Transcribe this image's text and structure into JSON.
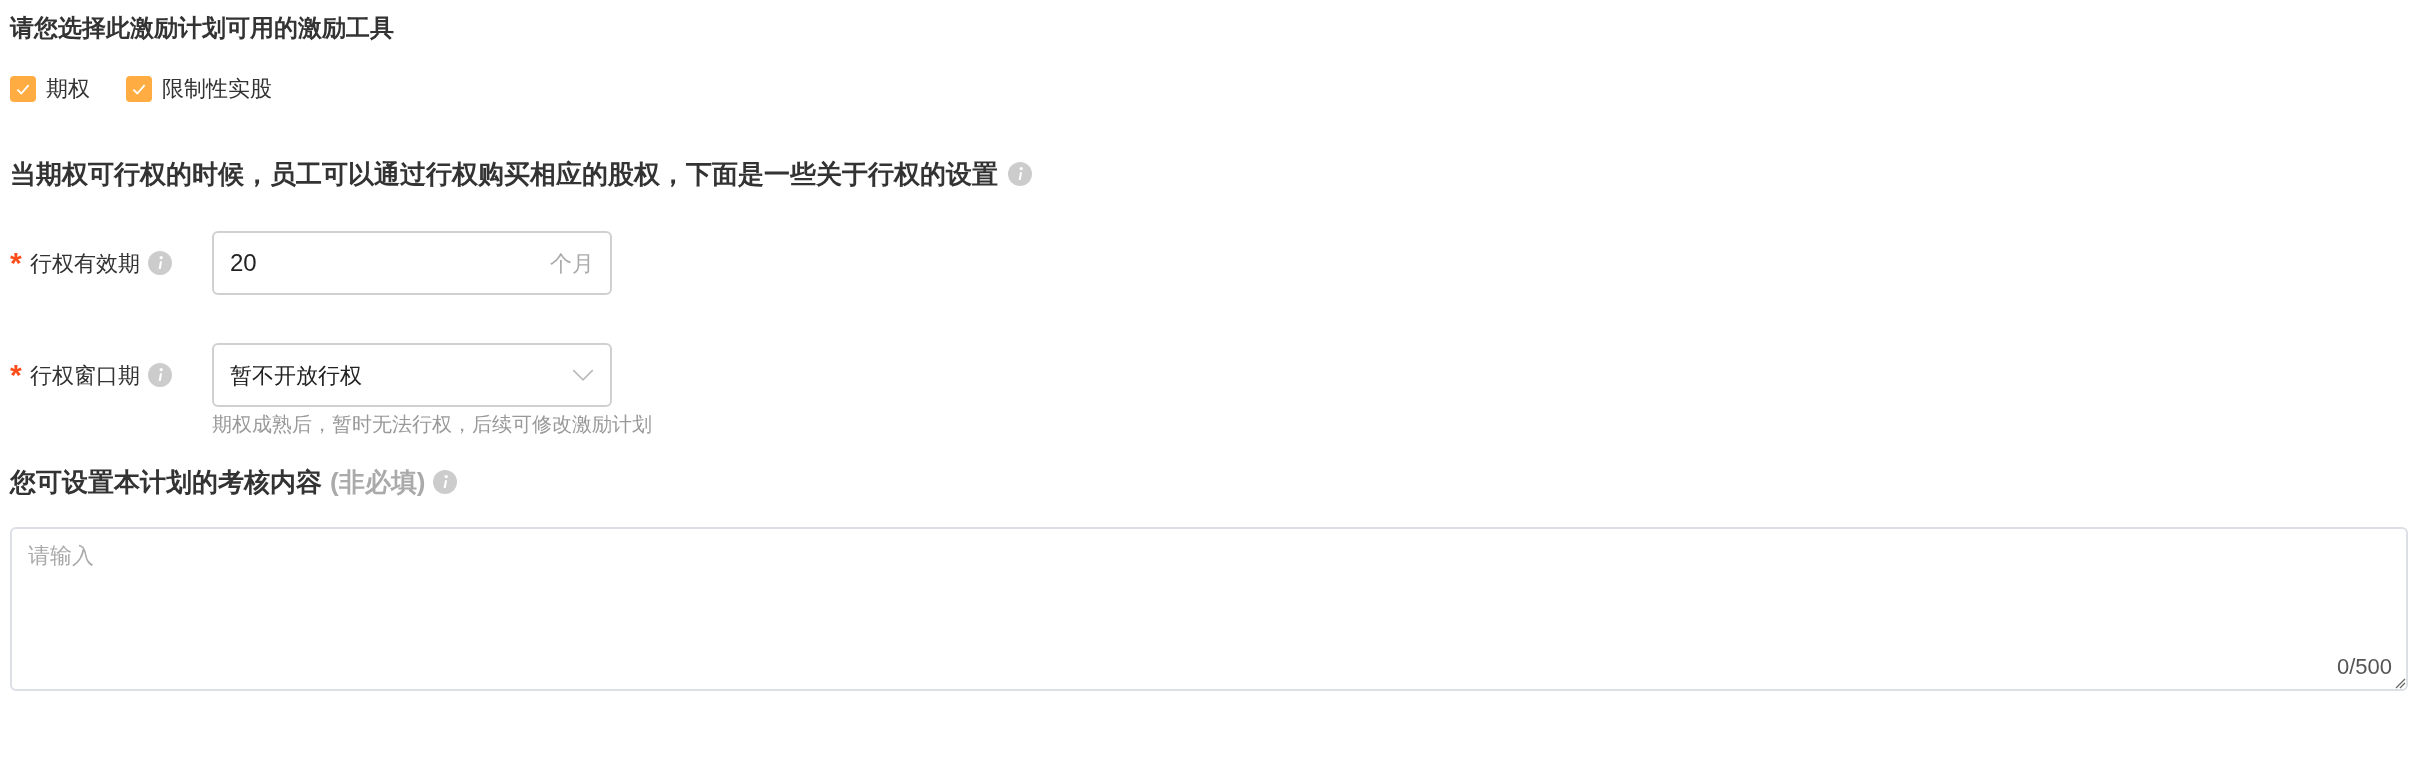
{
  "tools_section": {
    "title": "请您选择此激励计划可用的激励工具",
    "options": [
      {
        "label": "期权",
        "checked": true
      },
      {
        "label": "限制性实股",
        "checked": true
      }
    ]
  },
  "exercise_section": {
    "title": "当期权可行权的时候，员工可以通过行权购买相应的股权，下面是一些关于行权的设置",
    "fields": [
      {
        "kind": "input",
        "label": "行权有效期",
        "required_mark": "*",
        "value": "20",
        "suffix": "个月"
      },
      {
        "kind": "select",
        "label": "行权窗口期",
        "required_mark": "*",
        "value": "暂不开放行权",
        "hint": "期权成熟后，暂时无法行权，后续可修改激励计划"
      }
    ]
  },
  "assessment_section": {
    "title": "您可设置本计划的考核内容",
    "note": "(非必填)",
    "placeholder": "请输入",
    "counter": "0/500"
  }
}
